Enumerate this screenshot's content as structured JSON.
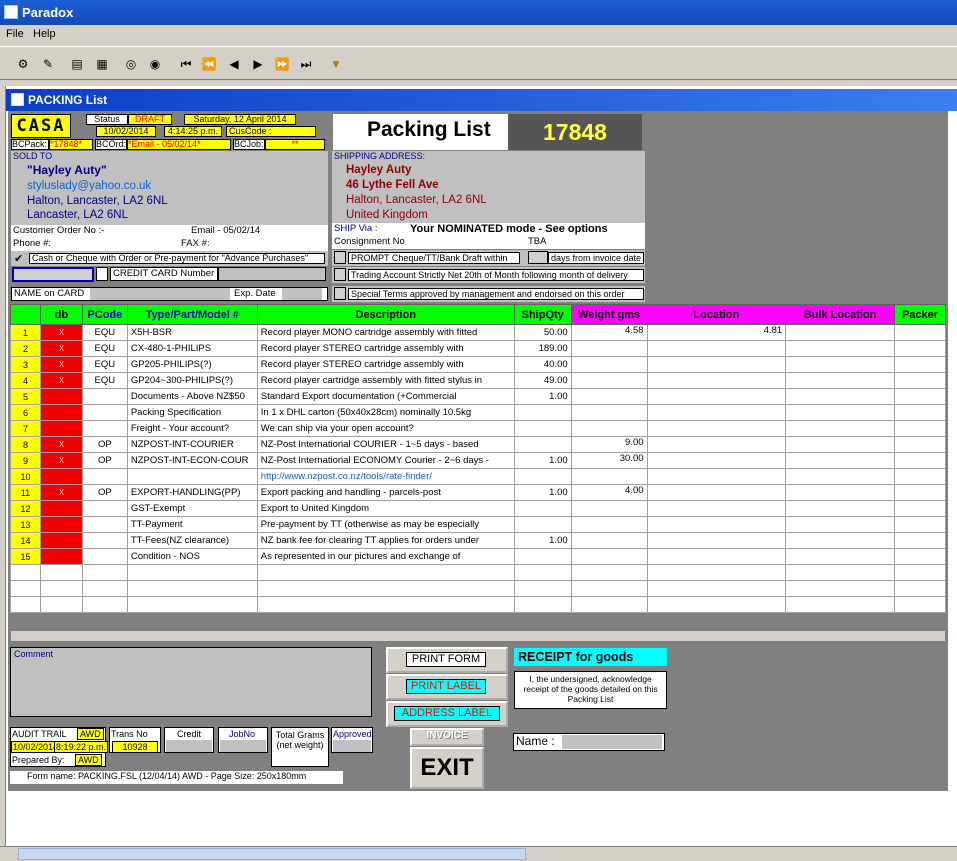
{
  "app": {
    "title": "Paradox",
    "menu": [
      "File",
      "Help"
    ]
  },
  "window": {
    "title": "PACKING List"
  },
  "header": {
    "logo": "CASA",
    "status_label": "Status",
    "status_value": "DRAFT",
    "date_long": "Saturday, 12 April 2014",
    "date": "10/02/2014",
    "time": "4:14:25 p.m.",
    "cuscode_label": "CusCode :",
    "bcpack_label": "BCPack:",
    "bcpack_value": "*17848*",
    "bcord_label": "BCOrd:",
    "bcord_value": "*Email - 05/02/14*",
    "bcjob_label": "BCJob:",
    "bcjob_value": "**",
    "form_title": "Packing List",
    "number": "17848"
  },
  "sold_to": {
    "label": "SOLD TO",
    "name": "\"Hayley Auty\"",
    "email": "styluslady@yahoo.co.uk",
    "line1": "Halton, Lancaster, LA2 6NL",
    "line2": "Lancaster, LA2 6NL",
    "customer_order_label": "Customer Order  No :-",
    "email_label": "Email - 05/02/14",
    "phone_label": "Phone #:",
    "fax_label": "FAX #:",
    "payment_text": "Cash or Cheque with Order or Pre-payment for \"Advance Purchases\"",
    "credit_card_label": "CREDIT CARD Number",
    "name_on_card_label": "NAME on CARD",
    "exp_label": "Exp. Date"
  },
  "ship_to": {
    "label": "SHIPPING ADDRESS:",
    "name": "Hayley Auty",
    "line1": "46 Lythe Fell Ave",
    "line2": "Halton, Lancaster, LA2 6NL",
    "line3": "United Kingdom",
    "ship_via_label": "SHIP Via :",
    "ship_via_value": "Your NOMINATED mode - See options",
    "consignment_label": "Consignment No",
    "consignment_value": "TBA",
    "prompt_text": "PROMPT Cheque/TT/Bank Draft within",
    "days_text": "days  from  invoice date",
    "trading_text": "Trading Account Strictly Net 20th of Month following month of delivery",
    "special_text": "Special Terms approved by management and endorsed on this order"
  },
  "columns": [
    "db",
    "PCode",
    "Type/Part/Model #",
    "Description",
    "ShipQty",
    "Weight gms",
    "Location",
    "Bulk Location",
    "Packer"
  ],
  "rows": [
    {
      "n": "1",
      "db": "X",
      "pcode": "EQU",
      "part": "X5H-BSR",
      "desc": "Record player MONO cartridge assembly with fitted",
      "qty": "50.00",
      "weight": "4.58",
      "loc": "4.81"
    },
    {
      "n": "2",
      "db": "X",
      "pcode": "EQU",
      "part": "CX-480-1-PHILIPS",
      "desc": "Record player STEREO cartridge assembly with",
      "qty": "189.00",
      "weight": "",
      "loc": ""
    },
    {
      "n": "3",
      "db": "X",
      "pcode": "EQU",
      "part": "GP205-PHILIPS(?)",
      "desc": "Record player STEREO cartridge assembly with",
      "qty": "40.00",
      "weight": "",
      "loc": ""
    },
    {
      "n": "4",
      "db": "X",
      "pcode": "EQU",
      "part": "GP204~300-PHILIPS(?)",
      "desc": "Record player cartridge assembly with fitted stylus in",
      "qty": "49.00",
      "weight": "",
      "loc": ""
    },
    {
      "n": "5",
      "db": "",
      "pcode": "",
      "part": "Documents - Above NZ$50",
      "desc": "Standard Export documentation (+Commercial",
      "qty": "1.00",
      "weight": "",
      "loc": ""
    },
    {
      "n": "6",
      "db": "",
      "pcode": "",
      "part": "Packing Specification",
      "desc": "In 1 x DHL carton (50x40x28cm) nominally 10.5kg",
      "qty": "",
      "weight": "",
      "loc": ""
    },
    {
      "n": "7",
      "db": "",
      "pcode": "",
      "part": "Freight - Your account?",
      "desc": "We can ship via your open account?",
      "qty": "",
      "weight": "",
      "loc": ""
    },
    {
      "n": "8",
      "db": "X",
      "pcode": "OP",
      "part": "NZPOST-INT-COURIER",
      "desc": "NZ-Post International COURIER - 1~5 days - based",
      "qty": "",
      "weight": "9.00",
      "loc": ""
    },
    {
      "n": "9",
      "db": "X",
      "pcode": "OP",
      "part": "NZPOST-INT-ECON-COUR",
      "desc": "NZ-Post International ECONOMY Courier - 2~6 days -",
      "qty": "1.00",
      "weight": "30.00",
      "loc": ""
    },
    {
      "n": "10",
      "db": "",
      "pcode": "",
      "part": "",
      "desc": "http://www.nzpost.co.nz/tools/rate-finder/",
      "qty": "",
      "weight": "",
      "loc": ""
    },
    {
      "n": "11",
      "db": "X",
      "pcode": "OP",
      "part": "EXPORT-HANDLING(PP)",
      "desc": "Export packing and handling - parcels-post",
      "qty": "1.00",
      "weight": "4.00",
      "loc": ""
    },
    {
      "n": "12",
      "db": "",
      "pcode": "",
      "part": "GST-Exempt",
      "desc": "Export to United Kingdom",
      "qty": "",
      "weight": "",
      "loc": ""
    },
    {
      "n": "13",
      "db": "",
      "pcode": "",
      "part": "TT-Payment",
      "desc": "Pre-payment by TT (otherwise as may be especially",
      "qty": "",
      "weight": "",
      "loc": ""
    },
    {
      "n": "14",
      "db": "",
      "pcode": "",
      "part": "TT-Fees(NZ clearance)",
      "desc": "NZ bank fee for clearing TT applies for orders under",
      "qty": "1.00",
      "weight": "",
      "loc": ""
    },
    {
      "n": "15",
      "db": "",
      "pcode": "",
      "part": "Condition - NOS",
      "desc": "As represented in our pictures and exchange of",
      "qty": "",
      "weight": "",
      "loc": ""
    }
  ],
  "footer": {
    "comment_label": "Comment",
    "print_form": "PRINT FORM",
    "print_label": "PRINT LABEL",
    "address_label": "ADDRESS LABEL",
    "invoice": "INVOICE",
    "exit": "EXIT",
    "receipt_title": "RECEIPT for goods",
    "receipt_text": "I, the undersigned, acknowledge receipt of the goods detailed on this Packing List",
    "name_label": "Name :",
    "audit_label": "AUDIT TRAIL",
    "audit_user": "AWD",
    "audit_date": "10/02/2014",
    "audit_time": "8:19:22 p.m.",
    "prepared_label": "Prepared By:",
    "prepared_user": "AWD",
    "trans_label": "Trans No",
    "trans_value": "10928",
    "credit_label": "Credit",
    "jobno_label": "JobNo",
    "total_grams_label": "Total Grams (net weight)",
    "approved_label": "Approved",
    "form_name": "Form name: PACKING.FSL (12/04/14) AWD -  Page Size: 250x180mm"
  }
}
